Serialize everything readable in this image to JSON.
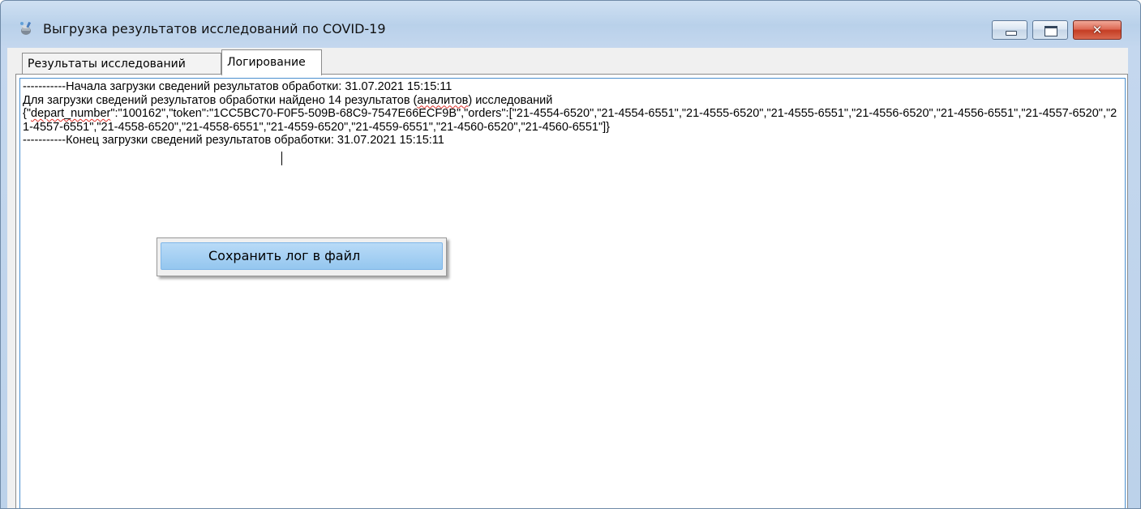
{
  "window": {
    "title": "Выгрузка результатов исследований по COVID-19",
    "icon": "app-icon",
    "controls": {
      "minimize_icon": "minimize-icon",
      "maximize_icon": "maximize-icon",
      "close_icon": "close-icon",
      "close_glyph": "✕"
    }
  },
  "tabs": [
    {
      "label": "Результаты исследований",
      "active": false
    },
    {
      "label": "Логирование",
      "active": true
    }
  ],
  "log": {
    "line1": "-----------Начала загрузки сведений результатов обработки: 31.07.2021 15:15:11",
    "line2_before": "Для загрузки сведений результатов обработки найдено 14 результатов (",
    "line2_misspelled": "аналитов",
    "line2_after": ") исследований",
    "line3_open": "{\"",
    "line3_misspelled": "depart_number",
    "line3_rest": "\":\"100162\",\"token\":\"1CC5BC70-F0F5-509B-68C9-7547E66ECF9B\",\"orders\":[\"21-4554-6520\",\"21-4554-6551\",\"21-4555-6520\",\"21-4555-6551\",\"21-4556-6520\",\"21-4556-6551\",\"21-4557-6520\",\"21-4557-6551\",\"21-4558-6520\",\"21-4558-6551\",\"21-4559-6520\",\"21-4559-6551\",\"21-4560-6520\",\"21-4560-6551\"]}",
    "line4": "-----------Конец загрузки сведений результатов обработки: 31.07.2021 15:15:11"
  },
  "context_menu": {
    "items": [
      {
        "label": "Сохранить лог в файл",
        "highlighted": true
      }
    ]
  },
  "colors": {
    "menu_highlight": "#94c6ef",
    "focus_border": "#4a8fcf",
    "close_button": "#c43d24",
    "titlebar": "#b9d1ea"
  }
}
